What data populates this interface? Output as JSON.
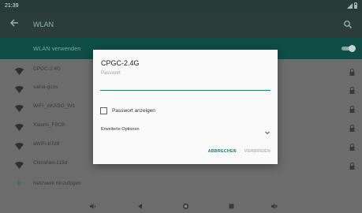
{
  "status_bar": {
    "time": "21:39"
  },
  "app_bar": {
    "title": "WLAN"
  },
  "wlan_toggle": {
    "label": "WLAN verwenden",
    "state": "on"
  },
  "networks": [
    {
      "name": "CPGC-2.4G",
      "locked": true
    },
    {
      "name": "saina-gcos",
      "locked": true
    },
    {
      "name": "WIFI_AKASO_W1",
      "locked": true
    },
    {
      "name": "Xiaomi_F8CB",
      "locked": true
    },
    {
      "name": "aWiFi-b7d9",
      "locked": true
    },
    {
      "name": "ChinaNet-115d",
      "locked": true
    }
  ],
  "add_network": {
    "label": "Netzwerk hinzufügen"
  },
  "dialog": {
    "title": "CPGC-2.4G",
    "password_label": "Passwort",
    "password_value": "",
    "show_password_label": "Passwort anzeigen",
    "show_password_checked": false,
    "advanced_label": "Erweiterte Optionen",
    "cancel_label": "ABBRECHEN",
    "connect_label": "VERBINDEN"
  },
  "nav_bar": {
    "icons": [
      "volume-down-icon",
      "back-icon",
      "home-icon",
      "recents-icon",
      "volume-up-icon"
    ]
  },
  "colors": {
    "accent": "#1f7f72",
    "app_bar": "#2c3d39",
    "wlan_bar": "#0e4e46",
    "scrim_background": "#6c6c6c"
  }
}
